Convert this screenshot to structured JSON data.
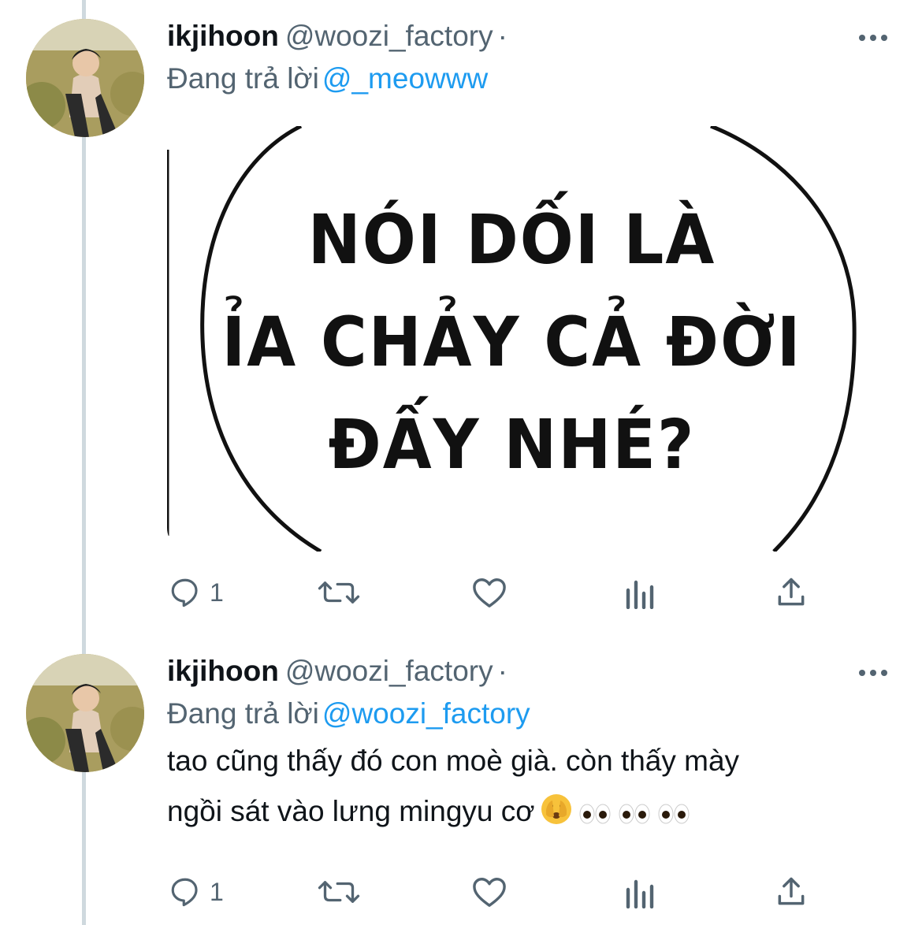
{
  "tweets": [
    {
      "author_name": "ikjihoon",
      "handle": "@woozi_factory",
      "separator": "·",
      "replying_prefix": "Đang trả lời",
      "replying_to": "@_meowww",
      "media_text_lines": [
        "NÓI DỐI LÀ",
        "ỈA CHẢY CẢ ĐỜI",
        "ĐẤY NHÉ?"
      ],
      "reply_count": "1"
    },
    {
      "author_name": "ikjihoon",
      "handle": "@woozi_factory",
      "separator": "·",
      "replying_prefix": "Đang trả lời",
      "replying_to": "@woozi_factory",
      "text_line1": "tao cũng thấy đó con moè già. còn thấy mày",
      "text_line2": "ngồi sát vào lưng mingyu cơ",
      "reply_count": "1"
    }
  ],
  "icons": [
    "more-icon",
    "reply-icon",
    "retweet-icon",
    "like-icon",
    "views-icon",
    "share-icon",
    "face-peeking-emoji",
    "eyes-emoji"
  ],
  "colors": {
    "text": "#0f1419",
    "secondary": "#536471",
    "mention": "#1d9bf0",
    "thread_line": "#cfd9de"
  }
}
